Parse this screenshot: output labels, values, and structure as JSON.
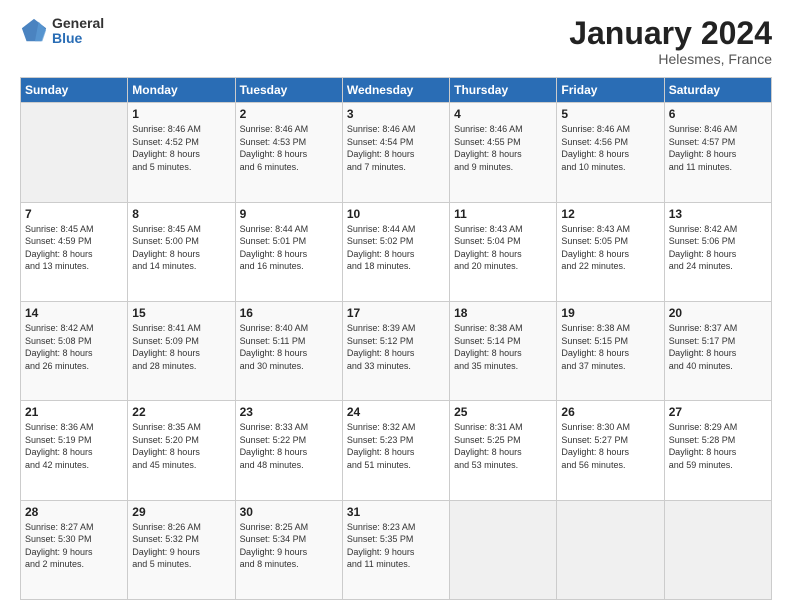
{
  "logo": {
    "general": "General",
    "blue": "Blue"
  },
  "title": "January 2024",
  "subtitle": "Helesmes, France",
  "headers": [
    "Sunday",
    "Monday",
    "Tuesday",
    "Wednesday",
    "Thursday",
    "Friday",
    "Saturday"
  ],
  "weeks": [
    [
      {
        "day": "",
        "info": ""
      },
      {
        "day": "1",
        "info": "Sunrise: 8:46 AM\nSunset: 4:52 PM\nDaylight: 8 hours\nand 5 minutes."
      },
      {
        "day": "2",
        "info": "Sunrise: 8:46 AM\nSunset: 4:53 PM\nDaylight: 8 hours\nand 6 minutes."
      },
      {
        "day": "3",
        "info": "Sunrise: 8:46 AM\nSunset: 4:54 PM\nDaylight: 8 hours\nand 7 minutes."
      },
      {
        "day": "4",
        "info": "Sunrise: 8:46 AM\nSunset: 4:55 PM\nDaylight: 8 hours\nand 9 minutes."
      },
      {
        "day": "5",
        "info": "Sunrise: 8:46 AM\nSunset: 4:56 PM\nDaylight: 8 hours\nand 10 minutes."
      },
      {
        "day": "6",
        "info": "Sunrise: 8:46 AM\nSunset: 4:57 PM\nDaylight: 8 hours\nand 11 minutes."
      }
    ],
    [
      {
        "day": "7",
        "info": "Sunrise: 8:45 AM\nSunset: 4:59 PM\nDaylight: 8 hours\nand 13 minutes."
      },
      {
        "day": "8",
        "info": "Sunrise: 8:45 AM\nSunset: 5:00 PM\nDaylight: 8 hours\nand 14 minutes."
      },
      {
        "day": "9",
        "info": "Sunrise: 8:44 AM\nSunset: 5:01 PM\nDaylight: 8 hours\nand 16 minutes."
      },
      {
        "day": "10",
        "info": "Sunrise: 8:44 AM\nSunset: 5:02 PM\nDaylight: 8 hours\nand 18 minutes."
      },
      {
        "day": "11",
        "info": "Sunrise: 8:43 AM\nSunset: 5:04 PM\nDaylight: 8 hours\nand 20 minutes."
      },
      {
        "day": "12",
        "info": "Sunrise: 8:43 AM\nSunset: 5:05 PM\nDaylight: 8 hours\nand 22 minutes."
      },
      {
        "day": "13",
        "info": "Sunrise: 8:42 AM\nSunset: 5:06 PM\nDaylight: 8 hours\nand 24 minutes."
      }
    ],
    [
      {
        "day": "14",
        "info": "Sunrise: 8:42 AM\nSunset: 5:08 PM\nDaylight: 8 hours\nand 26 minutes."
      },
      {
        "day": "15",
        "info": "Sunrise: 8:41 AM\nSunset: 5:09 PM\nDaylight: 8 hours\nand 28 minutes."
      },
      {
        "day": "16",
        "info": "Sunrise: 8:40 AM\nSunset: 5:11 PM\nDaylight: 8 hours\nand 30 minutes."
      },
      {
        "day": "17",
        "info": "Sunrise: 8:39 AM\nSunset: 5:12 PM\nDaylight: 8 hours\nand 33 minutes."
      },
      {
        "day": "18",
        "info": "Sunrise: 8:38 AM\nSunset: 5:14 PM\nDaylight: 8 hours\nand 35 minutes."
      },
      {
        "day": "19",
        "info": "Sunrise: 8:38 AM\nSunset: 5:15 PM\nDaylight: 8 hours\nand 37 minutes."
      },
      {
        "day": "20",
        "info": "Sunrise: 8:37 AM\nSunset: 5:17 PM\nDaylight: 8 hours\nand 40 minutes."
      }
    ],
    [
      {
        "day": "21",
        "info": "Sunrise: 8:36 AM\nSunset: 5:19 PM\nDaylight: 8 hours\nand 42 minutes."
      },
      {
        "day": "22",
        "info": "Sunrise: 8:35 AM\nSunset: 5:20 PM\nDaylight: 8 hours\nand 45 minutes."
      },
      {
        "day": "23",
        "info": "Sunrise: 8:33 AM\nSunset: 5:22 PM\nDaylight: 8 hours\nand 48 minutes."
      },
      {
        "day": "24",
        "info": "Sunrise: 8:32 AM\nSunset: 5:23 PM\nDaylight: 8 hours\nand 51 minutes."
      },
      {
        "day": "25",
        "info": "Sunrise: 8:31 AM\nSunset: 5:25 PM\nDaylight: 8 hours\nand 53 minutes."
      },
      {
        "day": "26",
        "info": "Sunrise: 8:30 AM\nSunset: 5:27 PM\nDaylight: 8 hours\nand 56 minutes."
      },
      {
        "day": "27",
        "info": "Sunrise: 8:29 AM\nSunset: 5:28 PM\nDaylight: 8 hours\nand 59 minutes."
      }
    ],
    [
      {
        "day": "28",
        "info": "Sunrise: 8:27 AM\nSunset: 5:30 PM\nDaylight: 9 hours\nand 2 minutes."
      },
      {
        "day": "29",
        "info": "Sunrise: 8:26 AM\nSunset: 5:32 PM\nDaylight: 9 hours\nand 5 minutes."
      },
      {
        "day": "30",
        "info": "Sunrise: 8:25 AM\nSunset: 5:34 PM\nDaylight: 9 hours\nand 8 minutes."
      },
      {
        "day": "31",
        "info": "Sunrise: 8:23 AM\nSunset: 5:35 PM\nDaylight: 9 hours\nand 11 minutes."
      },
      {
        "day": "",
        "info": ""
      },
      {
        "day": "",
        "info": ""
      },
      {
        "day": "",
        "info": ""
      }
    ]
  ]
}
